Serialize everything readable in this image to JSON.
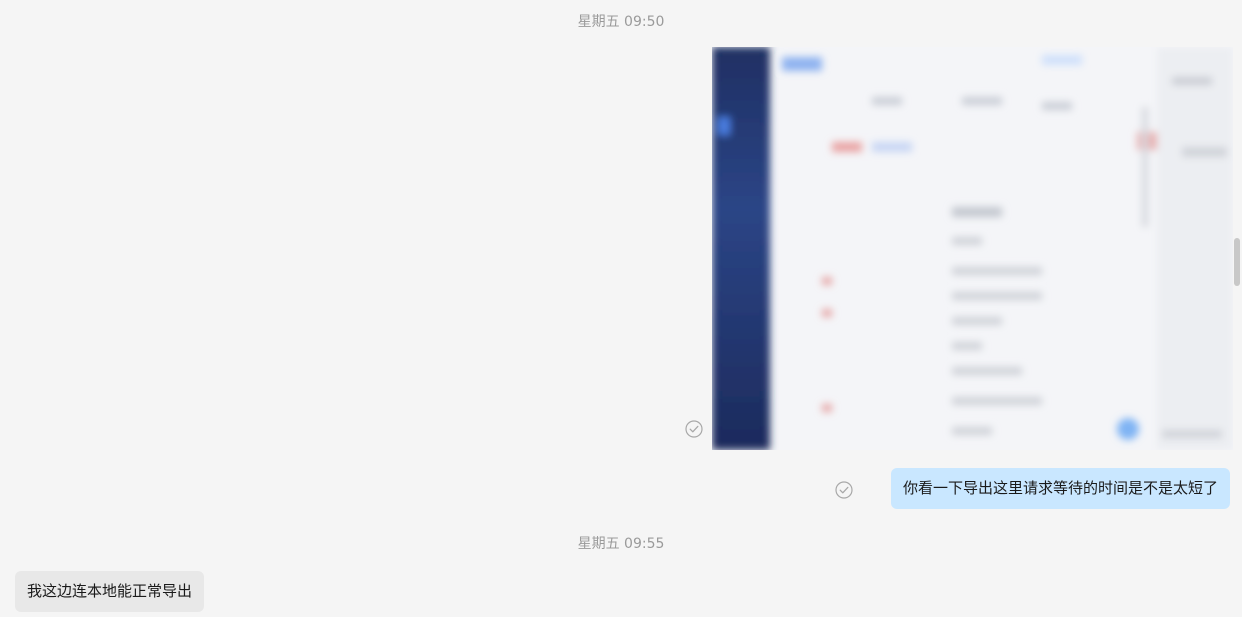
{
  "messages": {
    "time_1": "星期五 09:50",
    "outgoing_text": "你看一下导出这里请求等待的时间是不是太短了",
    "time_2": "星期五 09:55",
    "incoming_text": "我这边连本地能正常导出"
  },
  "icons": {
    "read_status": "check-circle-icon"
  },
  "colors": {
    "background": "#f5f5f5",
    "outgoing_bubble": "#c9e7ff",
    "incoming_bubble": "#e8e8e8",
    "timestamp_text": "#9a9a9a"
  }
}
